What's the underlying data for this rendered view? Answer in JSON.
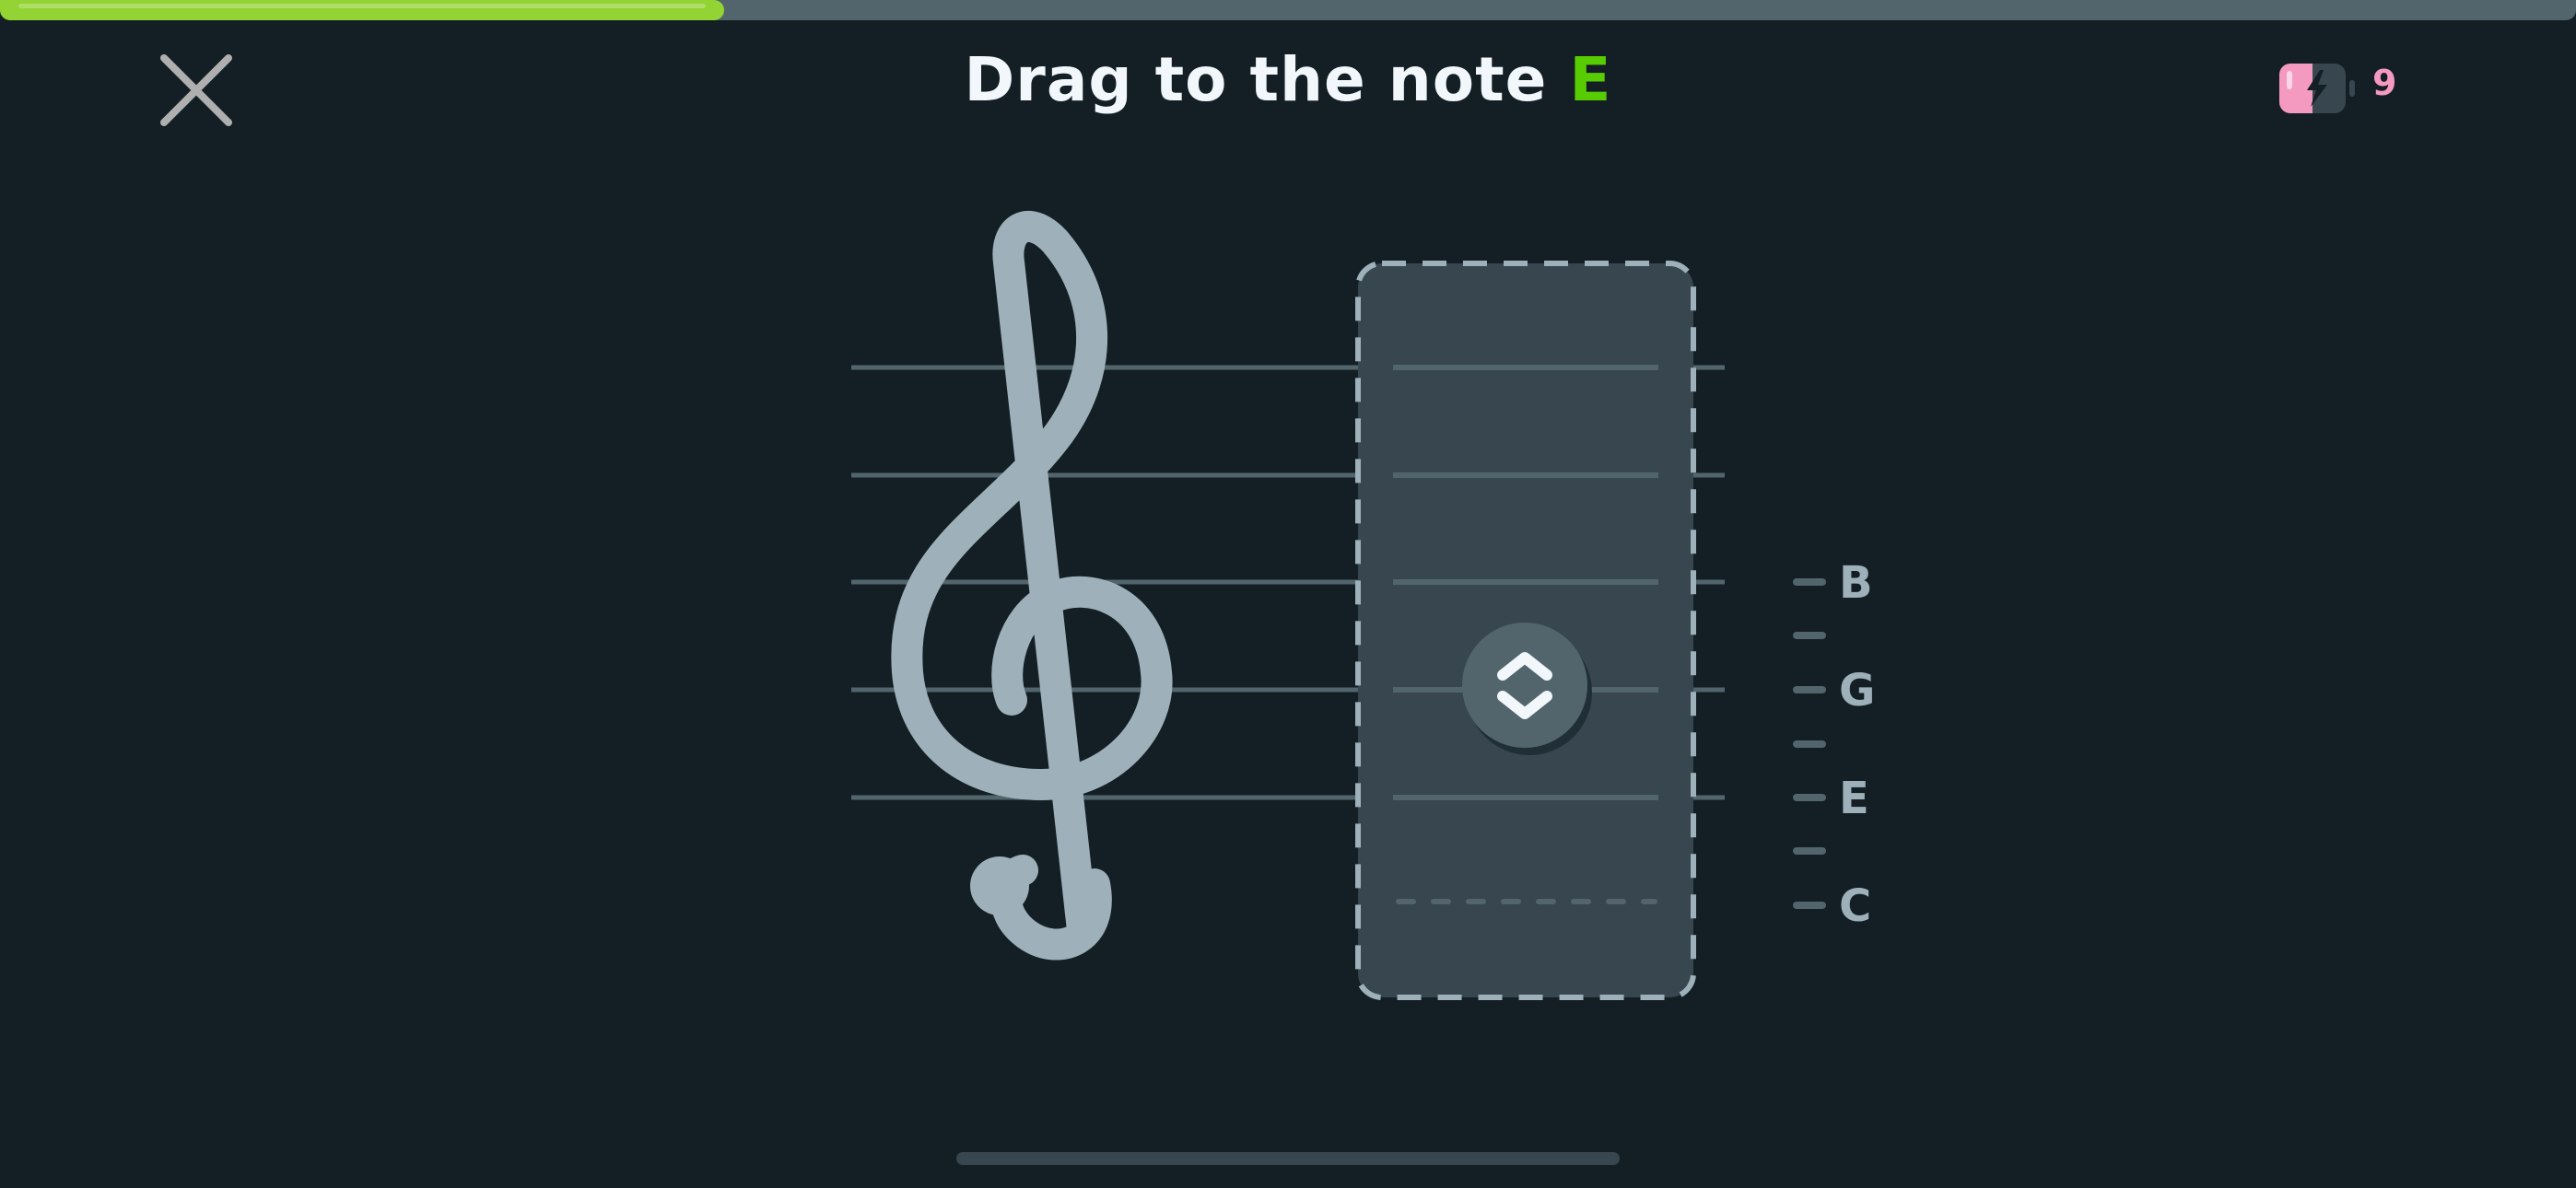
{
  "header": {
    "progress_fraction": 0.281,
    "title_prefix": "Drag to the note",
    "title_note": "E",
    "energy_count": "9"
  },
  "staff": {
    "guide_labels": [
      "B",
      "G",
      "E",
      "C"
    ],
    "answer_zone_icon": "drag-up-down-icon"
  },
  "colors": {
    "background": "#131f24",
    "progress_fill": "#93d333",
    "progress_track": "#52656d",
    "note_highlight": "#58cc02",
    "staff_line": "#52656d",
    "clef": "#9eb0b9",
    "energy": "#f49ac1"
  }
}
